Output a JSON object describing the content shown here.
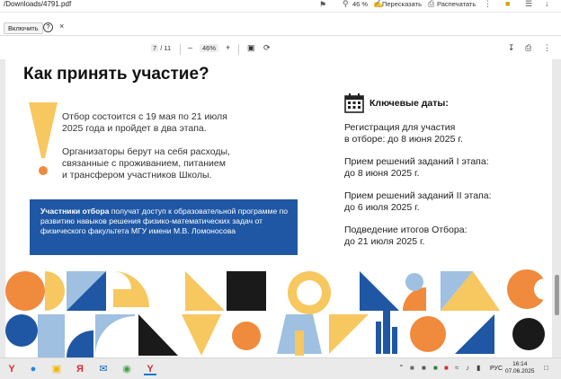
{
  "browser": {
    "path": "/Downloads/4791.pdf",
    "zoom_label": "46 %",
    "retell_label": "Пересказать",
    "print_label": "Распечатать"
  },
  "extension_bar": {
    "enable_label": "Включить",
    "help_glyph": "?",
    "close_glyph": "×"
  },
  "pdf_toolbar": {
    "page_current": "7",
    "page_total": "/ 11",
    "zoom": "46%",
    "zoom_out": "–",
    "zoom_in": "+"
  },
  "document": {
    "heading": "Как принять участие?",
    "selection_text": "Отбор состоится с 19 мая по 21 июля\n2025 года и пройдет в два этапа.",
    "costs_text": "Организаторы берут на себя расходы,\nсвязанные с проживанием, питанием\nи трансфером участников Школы.",
    "participants_bold": "Участники отбора",
    "participants_text": " получат доступ к образовательной программе по развитию навыков решения физико-математических задач от физического факультета МГУ имени М.В. Ломоносова",
    "key_dates_title": "Ключевые даты:",
    "dates": [
      "Регистрация для участия\nв отборе: до 8 июня 2025 г.",
      "Прием решений заданий I этапа:\nдо 8 июня 2025 г.",
      "Прием решений заданий II этапа:\nдо 6 июля 2025 г.",
      "Подведение итогов Отбора:\nдо 21 июля 2025 г."
    ]
  },
  "taskbar": {
    "lang": "РУС",
    "time": "16:14",
    "date": "07.06.2025"
  },
  "colors": {
    "blue": "#1f57a4",
    "orange": "#f08a3c",
    "yellow": "#f7c760",
    "lightblue": "#9fc0e0",
    "black": "#1a1a1a"
  }
}
